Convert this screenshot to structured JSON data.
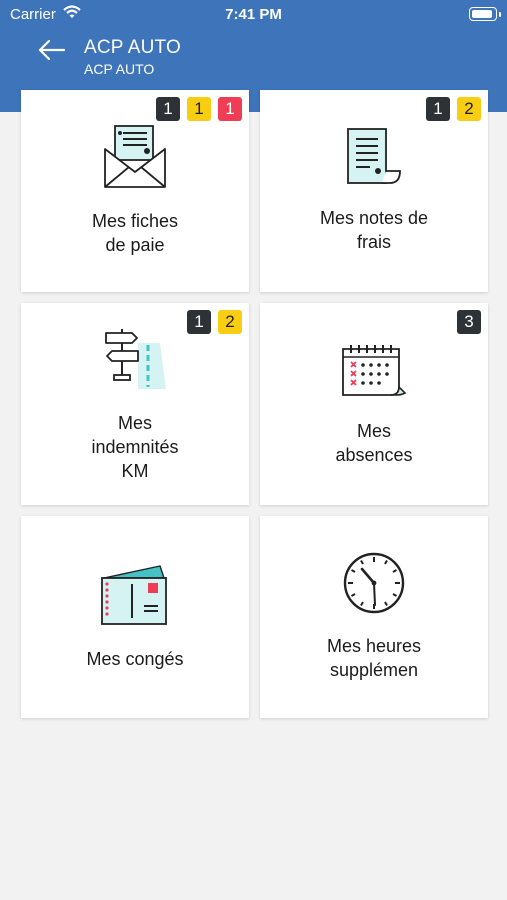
{
  "status_bar": {
    "carrier": "Carrier",
    "time": "7:41 PM"
  },
  "header": {
    "title": "ACP AUTO",
    "subtitle": "ACP AUTO"
  },
  "tiles": [
    {
      "label": "Mes fiches\nde paie",
      "icon": "payslip-envelope-icon",
      "badges": [
        "1",
        "1",
        "1"
      ]
    },
    {
      "label": "Mes notes de\nfrais",
      "icon": "receipt-icon",
      "badges": [
        "1",
        "2"
      ]
    },
    {
      "label": "Mes\nindemnités\nKM",
      "icon": "signpost-road-icon",
      "badges": [
        "1",
        "2"
      ]
    },
    {
      "label": "Mes\nabsences",
      "icon": "calendar-icon",
      "badges": [
        "3"
      ]
    },
    {
      "label": "Mes congés",
      "icon": "ticket-icon",
      "badges": []
    },
    {
      "label": "Mes heures\nsupplémen",
      "icon": "clock-icon",
      "badges": []
    }
  ],
  "colors": {
    "header": "#3e74b9",
    "badge_dark": "#2d3237",
    "badge_yellow": "#f9cd11",
    "badge_red": "#ee3d55",
    "accent_teal": "#44c2c6"
  }
}
